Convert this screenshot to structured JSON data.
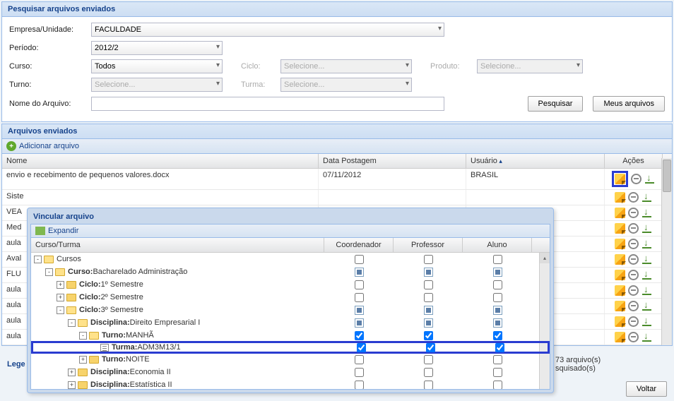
{
  "search_panel": {
    "title": "Pesquisar arquivos enviados",
    "labels": {
      "empresa": "Empresa/Unidade:",
      "periodo": "Período:",
      "curso": "Curso:",
      "turno": "Turno:",
      "ciclo": "Ciclo:",
      "turma": "Turma:",
      "produto": "Produto:",
      "nome_arquivo": "Nome do Arquivo:"
    },
    "values": {
      "empresa": "FACULDADE",
      "periodo": "2012/2",
      "curso": "Todos",
      "turno": "Selecione...",
      "ciclo": "Selecione...",
      "turma": "Selecione...",
      "produto": "Selecione..."
    },
    "buttons": {
      "pesquisar": "Pesquisar",
      "meus_arquivos": "Meus arquivos"
    }
  },
  "files_panel": {
    "title": "Arquivos enviados",
    "add_label": "Adicionar arquivo",
    "columns": {
      "nome": "Nome",
      "data": "Data Postagem",
      "usuario": "Usuário",
      "acoes": "Ações"
    },
    "rows": [
      {
        "nome": "envio e recebimento de pequenos valores.docx",
        "data": "07/11/2012",
        "usuario": "BRASIL"
      },
      {
        "nome": "Siste",
        "data": "",
        "usuario": ""
      },
      {
        "nome": "VEA",
        "data": "",
        "usuario": ""
      },
      {
        "nome": "Med",
        "data": "",
        "usuario": ""
      },
      {
        "nome": "aula",
        "data": "",
        "usuario": ""
      },
      {
        "nome": "Aval",
        "data": "",
        "usuario": ""
      },
      {
        "nome": "FLU",
        "data": "",
        "usuario": ""
      },
      {
        "nome": "aula",
        "data": "",
        "usuario": ""
      },
      {
        "nome": "aula",
        "data": "",
        "usuario": ""
      },
      {
        "nome": "aula",
        "data": "",
        "usuario": ""
      },
      {
        "nome": "aula",
        "data": "",
        "usuario": ""
      }
    ]
  },
  "modal": {
    "title": "Vincular arquivo",
    "expand": "Expandir",
    "columns": {
      "curso_turma": "Curso/Turma",
      "coordenador": "Coordenador",
      "professor": "Professor",
      "aluno": "Aluno"
    },
    "tree": [
      {
        "indent": 0,
        "toggle": "-",
        "folder": "open",
        "label_b": "",
        "label": "Cursos",
        "cb": [
          "empty",
          "empty",
          "empty"
        ]
      },
      {
        "indent": 1,
        "toggle": "-",
        "folder": "open",
        "label_b": "Curso:",
        "label": "Bacharelado Administração",
        "cb": [
          "partial",
          "partial",
          "partial"
        ]
      },
      {
        "indent": 2,
        "toggle": "+",
        "folder": "closed",
        "label_b": "Ciclo:",
        "label": "1º Semestre",
        "cb": [
          "empty",
          "empty",
          "empty"
        ]
      },
      {
        "indent": 2,
        "toggle": "+",
        "folder": "closed",
        "label_b": "Ciclo:",
        "label": "2º Semestre",
        "cb": [
          "empty",
          "empty",
          "empty"
        ]
      },
      {
        "indent": 2,
        "toggle": "-",
        "folder": "open",
        "label_b": "Ciclo:",
        "label": "3º Semestre",
        "cb": [
          "partial",
          "partial",
          "partial"
        ]
      },
      {
        "indent": 3,
        "toggle": "-",
        "folder": "open",
        "label_b": "Disciplina:",
        "label": "Direito Empresarial I",
        "cb": [
          "partial",
          "partial",
          "partial"
        ]
      },
      {
        "indent": 4,
        "toggle": "-",
        "folder": "open",
        "label_b": "Turno:",
        "label": "MANHÃ",
        "cb": [
          "checked",
          "checked",
          "checked"
        ]
      },
      {
        "indent": 5,
        "toggle": "",
        "folder": "leaf",
        "label_b": "Turma:",
        "label": "ADM3M13/1",
        "cb": [
          "checked",
          "checked",
          "checked"
        ],
        "highlight": true
      },
      {
        "indent": 4,
        "toggle": "+",
        "folder": "closed",
        "label_b": "Turno:",
        "label": "NOITE",
        "cb": [
          "empty",
          "empty",
          "empty"
        ]
      },
      {
        "indent": 3,
        "toggle": "+",
        "folder": "closed",
        "label_b": "Disciplina:",
        "label": "Economia II",
        "cb": [
          "empty",
          "empty",
          "empty"
        ]
      },
      {
        "indent": 3,
        "toggle": "+",
        "folder": "closed",
        "label_b": "Disciplina:",
        "label": "Estatística II",
        "cb": [
          "empty",
          "empty",
          "empty"
        ]
      }
    ]
  },
  "status": {
    "line1": "73 arquivo(s)",
    "line2": "squisado(s)"
  },
  "legend_fragment": "Lege",
  "voltar": "Voltar"
}
